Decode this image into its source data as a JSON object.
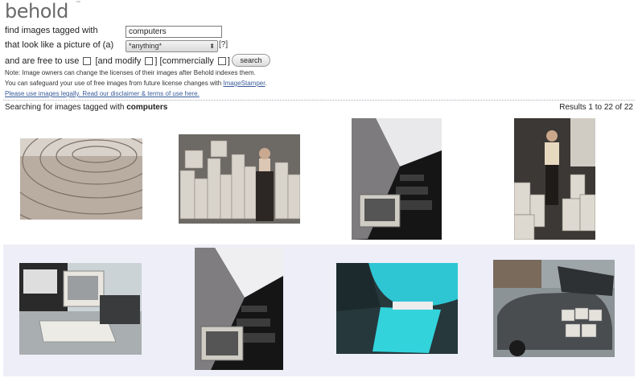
{
  "logo": {
    "text": "behold",
    "trademark": "™"
  },
  "search_form": {
    "tagged_label": "find images tagged with",
    "tag_value": "computers",
    "look_label": "that look like a picture of (a)",
    "look_selected": "*anything*",
    "help_text": "[?]",
    "free_label": "and are free to use",
    "modify_label": "[and modify",
    "modify_close": "]",
    "commercial_label": "[commercially",
    "commercial_close": "]",
    "search_button": "search"
  },
  "notes": {
    "line1": "Note: Image owners can change the licenses of their images after Behold indexes them.",
    "line2_prefix": "You can safeguard your use of free images from future license changes with ",
    "line2_link": "ImageStamper",
    "line2_suffix": ".",
    "line3": "Please use images legally. Read our disclaimer & terms of use here."
  },
  "results_header": {
    "searching_prefix": "Searching for images tagged with ",
    "searching_term": "computers",
    "results_text": "Results 1 to 22 of 22"
  },
  "results": [
    {
      "subject": "pavement-photo"
    },
    {
      "subject": "man-with-computers-photo"
    },
    {
      "subject": "monitor-corridor-photo"
    },
    {
      "subject": "man-standing-computers-photo"
    },
    {
      "subject": "crt-computer-desk-photo"
    },
    {
      "subject": "monitor-corridor-photo"
    },
    {
      "subject": "cyan-abstract-photo"
    },
    {
      "subject": "car-with-monitors-photo"
    }
  ],
  "colors": {
    "link": "#3a5b9a",
    "row_highlight": "#eeeef8",
    "cyan": "#2fc6d4"
  }
}
